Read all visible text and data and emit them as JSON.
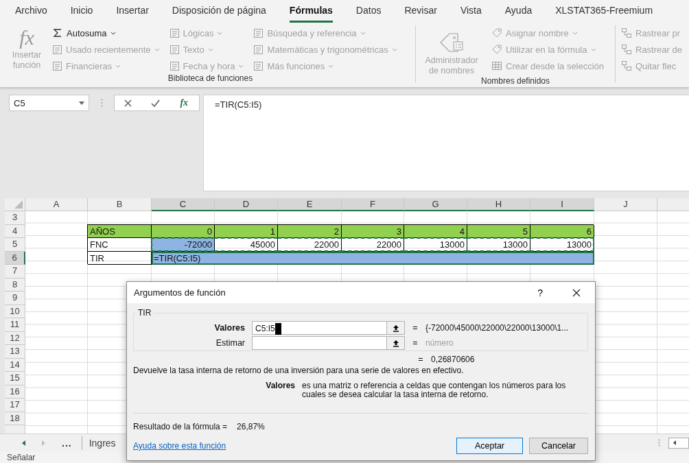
{
  "ribbon_tabs": [
    {
      "label": "Archivo",
      "selected": false
    },
    {
      "label": "Inicio",
      "selected": false
    },
    {
      "label": "Insertar",
      "selected": false
    },
    {
      "label": "Disposición de página",
      "selected": false
    },
    {
      "label": "Fórmulas",
      "selected": true
    },
    {
      "label": "Datos",
      "selected": false
    },
    {
      "label": "Revisar",
      "selected": false
    },
    {
      "label": "Vista",
      "selected": false
    },
    {
      "label": "Ayuda",
      "selected": false
    },
    {
      "label": "XLSTAT365-Freemium",
      "selected": false
    }
  ],
  "ribbon_groups": [
    {
      "title": "Biblioteca de funciones",
      "large_button": {
        "kind": "glyph",
        "glyph": "fx",
        "label": "Insertar función",
        "disabled": true
      },
      "columns": [
        {
          "items": [
            {
              "kind": "sum",
              "label": "Autosuma",
              "disabled": false,
              "dropdown": true
            },
            {
              "kind": "category",
              "label": "Usado recientemente",
              "disabled": true,
              "dropdown": true
            },
            {
              "kind": "category",
              "label": "Financieras",
              "disabled": true,
              "dropdown": true
            }
          ]
        },
        {
          "items": [
            {
              "kind": "category",
              "label": "Lógicas",
              "disabled": true,
              "dropdown": true
            },
            {
              "kind": "category",
              "label": "Texto",
              "disabled": true,
              "dropdown": true
            },
            {
              "kind": "category",
              "label": "Fecha y hora",
              "disabled": true,
              "dropdown": true
            }
          ]
        },
        {
          "items": [
            {
              "kind": "category",
              "label": "Búsqueda y referencia",
              "disabled": true,
              "dropdown": true
            },
            {
              "kind": "category",
              "label": "Matemáticas y trigonométricas",
              "disabled": true,
              "dropdown": true
            },
            {
              "kind": "category",
              "label": "Más funciones",
              "disabled": true,
              "dropdown": true
            }
          ]
        }
      ]
    },
    {
      "title": "Nombres definidos",
      "large_button": {
        "kind": "tag",
        "label": "Administrador de nombres",
        "disabled": true
      },
      "columns": [
        {
          "items": [
            {
              "kind": "tag",
              "label": "Asignar nombre",
              "disabled": true,
              "dropdown": true
            },
            {
              "kind": "tag",
              "label": "Utilizar en la fórmula",
              "disabled": true,
              "dropdown": true
            },
            {
              "kind": "table",
              "label": "Crear desde la selección",
              "disabled": true,
              "dropdown": false
            }
          ]
        }
      ]
    },
    {
      "columns": [
        {
          "items": [
            {
              "kind": "trace",
              "label": "Rastrear pr",
              "disabled": true,
              "dropdown": false
            },
            {
              "kind": "trace",
              "label": "Rastrear de",
              "disabled": true,
              "dropdown": false
            },
            {
              "kind": "trace",
              "label": "Quitar flec",
              "disabled": true,
              "dropdown": false
            }
          ]
        }
      ]
    }
  ],
  "formula_bar": {
    "name_box": "C5",
    "fx_label": "fx",
    "formula": "=TIR(C5:I5)"
  },
  "sheet": {
    "columns": [
      {
        "label": "A",
        "selected": false
      },
      {
        "label": "B",
        "selected": false
      },
      {
        "label": "C",
        "selected": true
      },
      {
        "label": "D",
        "selected": true
      },
      {
        "label": "E",
        "selected": true
      },
      {
        "label": "F",
        "selected": true
      },
      {
        "label": "G",
        "selected": true
      },
      {
        "label": "H",
        "selected": true
      },
      {
        "label": "I",
        "selected": true
      },
      {
        "label": "J",
        "selected": false
      }
    ],
    "rows": [
      {
        "label": "3",
        "selected": false
      },
      {
        "label": "4",
        "selected": false,
        "cells": [
          {
            "text": "AÑOS",
            "kind": "text",
            "color": "#92d050",
            "bordered": true,
            "selected": false,
            "active": false,
            "in_copy_range": false
          },
          {
            "text": "0",
            "kind": "number",
            "color": "#92d050",
            "bordered": true,
            "selected": false,
            "active": false,
            "in_copy_range": false
          },
          {
            "text": "1",
            "kind": "number",
            "color": "#92d050",
            "bordered": true,
            "selected": false,
            "active": false,
            "in_copy_range": false
          },
          {
            "text": "2",
            "kind": "number",
            "color": "#92d050",
            "bordered": true,
            "selected": false,
            "active": false,
            "in_copy_range": false
          },
          {
            "text": "3",
            "kind": "number",
            "color": "#92d050",
            "bordered": true,
            "selected": false,
            "active": false,
            "in_copy_range": false
          },
          {
            "text": "4",
            "kind": "number",
            "color": "#92d050",
            "bordered": true,
            "selected": false,
            "active": false,
            "in_copy_range": false
          },
          {
            "text": "5",
            "kind": "number",
            "color": "#92d050",
            "bordered": true,
            "selected": false,
            "active": false,
            "in_copy_range": false
          },
          {
            "text": "6",
            "kind": "number",
            "color": "#92d050",
            "bordered": true,
            "selected": false,
            "active": false,
            "in_copy_range": false
          }
        ]
      },
      {
        "label": "5",
        "selected": false,
        "cells": [
          {
            "text": "FNC",
            "kind": "text",
            "bordered": true,
            "selected": false,
            "active": false,
            "in_copy_range": false
          },
          {
            "text": "-72000",
            "kind": "number",
            "bordered": true,
            "selected": true,
            "active": false,
            "in_copy_range": true
          },
          {
            "text": "45000",
            "kind": "number",
            "bordered": true,
            "selected": false,
            "active": false,
            "in_copy_range": true
          },
          {
            "text": "22000",
            "kind": "number",
            "bordered": true,
            "selected": false,
            "active": false,
            "in_copy_range": true
          },
          {
            "text": "22000",
            "kind": "number",
            "bordered": true,
            "selected": false,
            "active": false,
            "in_copy_range": true
          },
          {
            "text": "13000",
            "kind": "number",
            "bordered": true,
            "selected": false,
            "active": false,
            "in_copy_range": true
          },
          {
            "text": "13000",
            "kind": "number",
            "bordered": true,
            "selected": false,
            "active": false,
            "in_copy_range": true
          },
          {
            "text": "13000",
            "kind": "number",
            "bordered": true,
            "selected": false,
            "active": false,
            "in_copy_range": true
          }
        ]
      },
      {
        "label": "6",
        "selected": true,
        "cells": [
          {
            "text": "TIR",
            "kind": "text",
            "bordered": true,
            "selected": false,
            "active": false,
            "in_copy_range": false
          },
          {
            "text": "=TIR(C5:I5)",
            "kind": "merged",
            "bordered": false,
            "selected": true,
            "active": true,
            "in_copy_range": false
          }
        ]
      },
      {
        "label": "7",
        "selected": false
      },
      {
        "label": "8",
        "selected": false
      },
      {
        "label": "9",
        "selected": false
      },
      {
        "label": "10",
        "selected": false
      },
      {
        "label": "11",
        "selected": false
      },
      {
        "label": "12",
        "selected": false
      },
      {
        "label": "13",
        "selected": false
      },
      {
        "label": "14",
        "selected": false
      },
      {
        "label": "15",
        "selected": false
      },
      {
        "label": "16",
        "selected": false
      },
      {
        "label": "17",
        "selected": false
      },
      {
        "label": "18",
        "selected": false
      }
    ]
  },
  "sheet_tabs": {
    "more": "...",
    "tabs": [
      {
        "label": "Ingres",
        "selected": false
      }
    ]
  },
  "status_bar": {
    "text": "Señalar"
  },
  "dialog": {
    "title": "Argumentos de función",
    "help": "?",
    "function_name": "TIR",
    "arguments": [
      {
        "label": "Valores",
        "value": "C5:I5",
        "focused": true,
        "sign": "=",
        "result": "{-72000\\45000\\22000\\22000\\13000\\1..."
      },
      {
        "label": "Estimar",
        "focused": false,
        "sign": "=",
        "hint": "número"
      }
    ],
    "result_sign": "=",
    "result": "0,26870606",
    "description": "Devuelve la tasa interna de retorno de una inversión para una serie de valores en efectivo.",
    "argument_help": {
      "name": "Valores",
      "text": "es una matriz o referencia a celdas que contengan los números para los cuales se desea calcular la tasa interna de retorno."
    },
    "formula_result_label": "Resultado de la fórmula =",
    "formula_result": "26,87%",
    "help_link": "Ayuda sobre esta función",
    "buttons": [
      {
        "label": "Aceptar",
        "default": true
      },
      {
        "label": "Cancelar",
        "default": false
      }
    ]
  }
}
